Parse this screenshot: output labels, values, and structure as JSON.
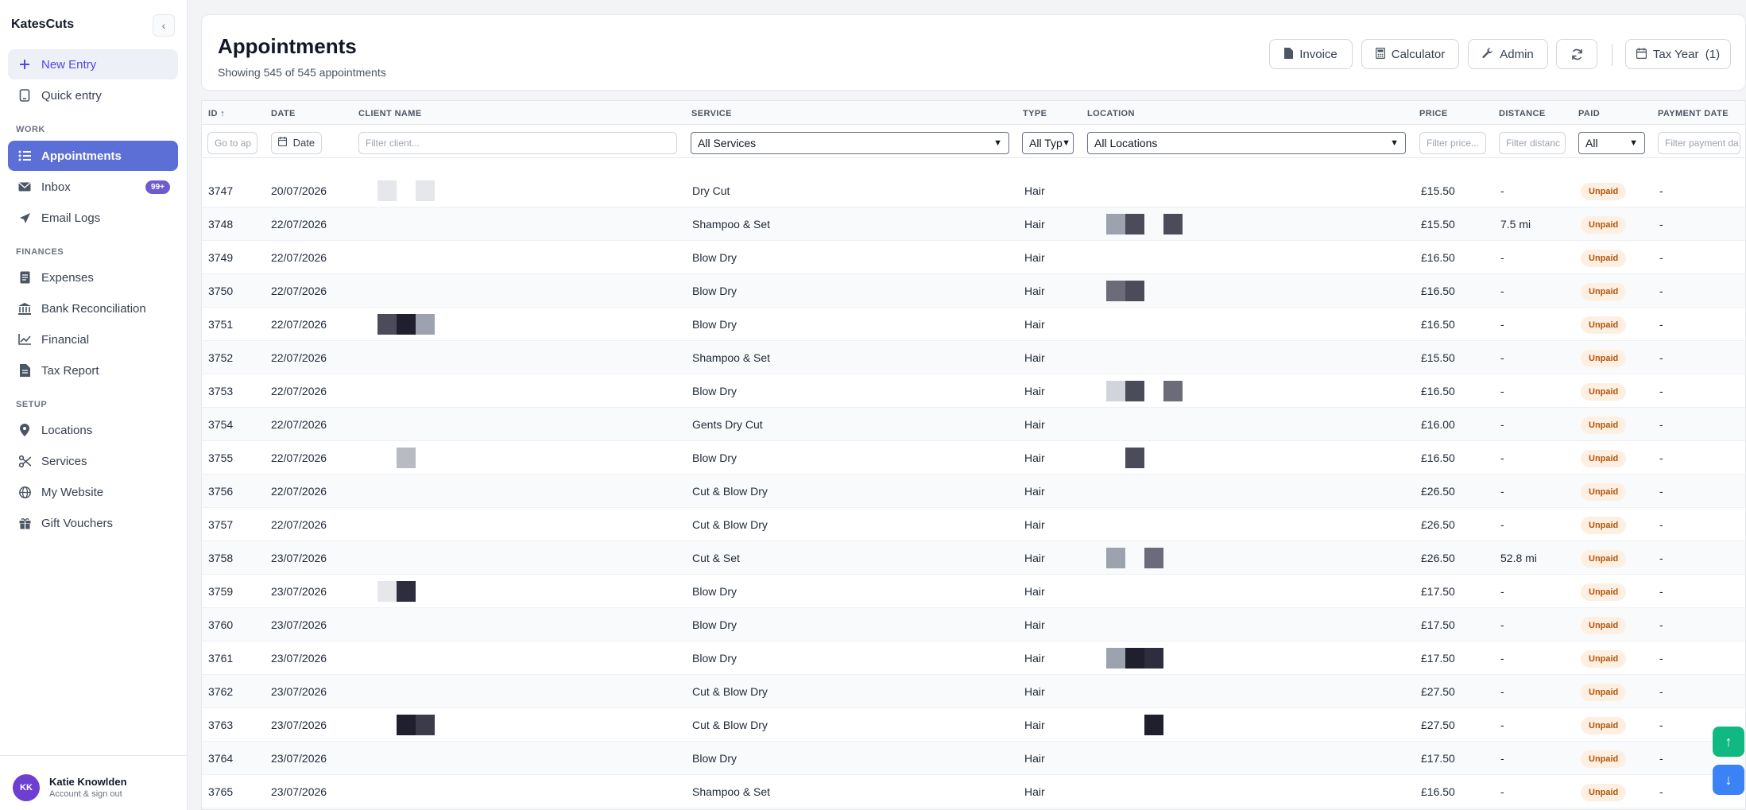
{
  "app": {
    "name": "KatesCuts",
    "collapse_icon": "chevron-left-icon"
  },
  "sidebar": {
    "new_entry": "New Entry",
    "quick_entry": "Quick entry",
    "sections": {
      "work": "WORK",
      "finances": "FINANCES",
      "setup": "SETUP"
    },
    "work": [
      {
        "label": "Appointments",
        "icon": "list-icon"
      },
      {
        "label": "Inbox",
        "icon": "mail-icon",
        "badge": "99+"
      },
      {
        "label": "Email Logs",
        "icon": "send-icon"
      }
    ],
    "finances": [
      {
        "label": "Expenses",
        "icon": "receipt-icon"
      },
      {
        "label": "Bank Reconciliation",
        "icon": "bank-icon"
      },
      {
        "label": "Financial",
        "icon": "chart-line-icon"
      },
      {
        "label": "Tax Report",
        "icon": "document-icon"
      }
    ],
    "setup": [
      {
        "label": "Locations",
        "icon": "map-pin-icon"
      },
      {
        "label": "Services",
        "icon": "scissors-icon"
      },
      {
        "label": "My Website",
        "icon": "globe-icon"
      },
      {
        "label": "Gift Vouchers",
        "icon": "gift-icon"
      }
    ],
    "user": {
      "initials": "KK",
      "name": "Katie Knowlden",
      "sub": "Account & sign out"
    }
  },
  "header": {
    "title": "Appointments",
    "subtitle": "Showing 545 of 545 appointments",
    "buttons": {
      "invoice": "Invoice",
      "calculator": "Calculator",
      "admin": "Admin",
      "tax_year": "Tax Year  (1)"
    }
  },
  "table": {
    "columns": {
      "id": "ID ↑",
      "date": "DATE",
      "client": "CLIENT NAME",
      "service": "SERVICE",
      "type": "TYPE",
      "location": "LOCATION",
      "price": "PRICE",
      "distance": "DISTANCE",
      "paid": "PAID",
      "payment_date": "PAYMENT DATE"
    },
    "filters": {
      "id_placeholder": "Go to ap",
      "date_label": "Date",
      "client_placeholder": "Filter client...",
      "service_selected": "All Services",
      "type_selected": "All Typ",
      "location_selected": "All Locations",
      "price_placeholder": "Filter price...",
      "distance_placeholder": "Filter distanc",
      "paid_selected": "All",
      "payment_placeholder": "Filter payment da"
    },
    "rows": [
      {
        "id": "3747",
        "date": "20/07/2026",
        "service": "Dry Cut",
        "type": "Hair",
        "price": "£15.50",
        "distance": "-",
        "paid": "Unpaid",
        "payment_date": "-"
      },
      {
        "id": "3748",
        "date": "22/07/2026",
        "service": "Shampoo & Set",
        "type": "Hair",
        "price": "£15.50",
        "distance": "7.5 mi",
        "paid": "Unpaid",
        "payment_date": "-"
      },
      {
        "id": "3749",
        "date": "22/07/2026",
        "service": "Blow Dry",
        "type": "Hair",
        "price": "£16.50",
        "distance": "-",
        "paid": "Unpaid",
        "payment_date": "-"
      },
      {
        "id": "3750",
        "date": "22/07/2026",
        "service": "Blow Dry",
        "type": "Hair",
        "price": "£16.50",
        "distance": "-",
        "paid": "Unpaid",
        "payment_date": "-"
      },
      {
        "id": "3751",
        "date": "22/07/2026",
        "service": "Blow Dry",
        "type": "Hair",
        "price": "£16.50",
        "distance": "-",
        "paid": "Unpaid",
        "payment_date": "-"
      },
      {
        "id": "3752",
        "date": "22/07/2026",
        "service": "Shampoo & Set",
        "type": "Hair",
        "price": "£15.50",
        "distance": "-",
        "paid": "Unpaid",
        "payment_date": "-"
      },
      {
        "id": "3753",
        "date": "22/07/2026",
        "service": "Blow Dry",
        "type": "Hair",
        "price": "£16.50",
        "distance": "-",
        "paid": "Unpaid",
        "payment_date": "-"
      },
      {
        "id": "3754",
        "date": "22/07/2026",
        "service": "Gents Dry Cut",
        "type": "Hair",
        "price": "£16.00",
        "distance": "-",
        "paid": "Unpaid",
        "payment_date": "-"
      },
      {
        "id": "3755",
        "date": "22/07/2026",
        "service": "Blow Dry",
        "type": "Hair",
        "price": "£16.50",
        "distance": "-",
        "paid": "Unpaid",
        "payment_date": "-"
      },
      {
        "id": "3756",
        "date": "22/07/2026",
        "service": "Cut & Blow Dry",
        "type": "Hair",
        "price": "£26.50",
        "distance": "-",
        "paid": "Unpaid",
        "payment_date": "-"
      },
      {
        "id": "3757",
        "date": "22/07/2026",
        "service": "Cut & Blow Dry",
        "type": "Hair",
        "price": "£26.50",
        "distance": "-",
        "paid": "Unpaid",
        "payment_date": "-"
      },
      {
        "id": "3758",
        "date": "23/07/2026",
        "service": "Cut & Set",
        "type": "Hair",
        "price": "£26.50",
        "distance": "52.8 mi",
        "paid": "Unpaid",
        "payment_date": "-"
      },
      {
        "id": "3759",
        "date": "23/07/2026",
        "service": "Blow Dry",
        "type": "Hair",
        "price": "£17.50",
        "distance": "-",
        "paid": "Unpaid",
        "payment_date": "-"
      },
      {
        "id": "3760",
        "date": "23/07/2026",
        "service": "Blow Dry",
        "type": "Hair",
        "price": "£17.50",
        "distance": "-",
        "paid": "Unpaid",
        "payment_date": "-"
      },
      {
        "id": "3761",
        "date": "23/07/2026",
        "service": "Blow Dry",
        "type": "Hair",
        "price": "£17.50",
        "distance": "-",
        "paid": "Unpaid",
        "payment_date": "-"
      },
      {
        "id": "3762",
        "date": "23/07/2026",
        "service": "Cut & Blow Dry",
        "type": "Hair",
        "price": "£27.50",
        "distance": "-",
        "paid": "Unpaid",
        "payment_date": "-"
      },
      {
        "id": "3763",
        "date": "23/07/2026",
        "service": "Cut & Blow Dry",
        "type": "Hair",
        "price": "£27.50",
        "distance": "-",
        "paid": "Unpaid",
        "payment_date": "-"
      },
      {
        "id": "3764",
        "date": "23/07/2026",
        "service": "Blow Dry",
        "type": "Hair",
        "price": "£17.50",
        "distance": "-",
        "paid": "Unpaid",
        "payment_date": "-"
      },
      {
        "id": "3765",
        "date": "23/07/2026",
        "service": "Shampoo & Set",
        "type": "Hair",
        "price": "£16.50",
        "distance": "-",
        "paid": "Unpaid",
        "payment_date": "-"
      }
    ]
  },
  "colors": {
    "accent": "#5b6fd6",
    "unpaid_bg": "#fdf0e3",
    "unpaid_text": "#b45309",
    "scroll_up": "#10b981",
    "scroll_down": "#3b82f6"
  }
}
